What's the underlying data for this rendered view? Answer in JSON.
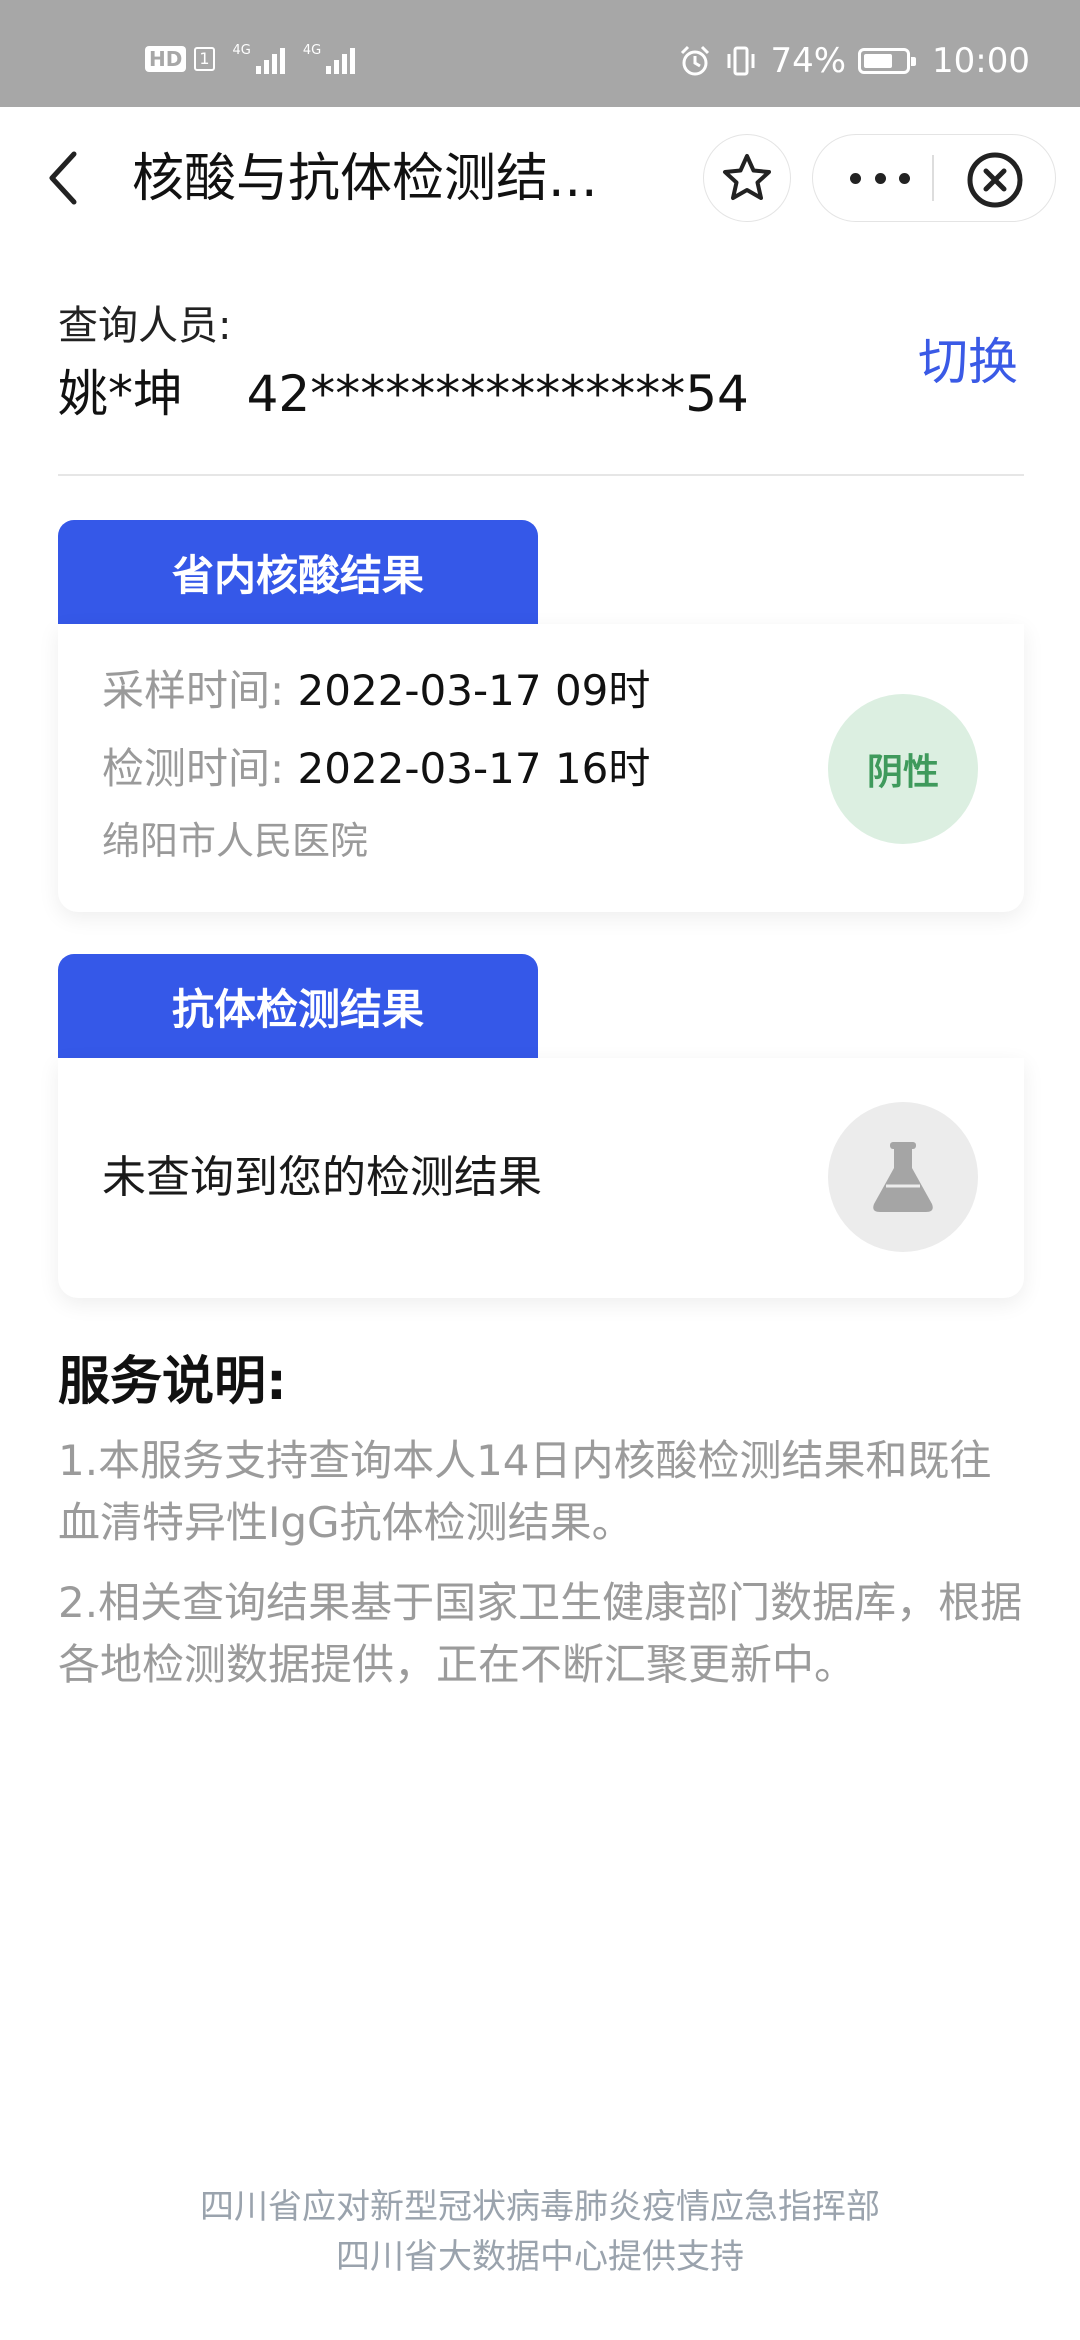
{
  "status_bar": {
    "hd": "HD",
    "sim": "1",
    "net1": "4G",
    "net2": "4G",
    "battery_pct": "74%",
    "battery_level": 0.74,
    "time": "10:00"
  },
  "nav": {
    "title": "核酸与抗体检测结..."
  },
  "user": {
    "label": "查询人员:",
    "name_id": "姚*坤    42***************54",
    "switch": "切换"
  },
  "nucleic": {
    "tab": "省内核酸结果",
    "sample_label": "采样时间:",
    "sample_value": "2022-03-17 09时",
    "test_label": "检测时间:",
    "test_value": "2022-03-17 16时",
    "hospital": "绵阳市人民医院",
    "result": "阴性"
  },
  "antibody": {
    "tab": "抗体检测结果",
    "message": "未查询到您的检测结果"
  },
  "service": {
    "title": "服务说明:",
    "p1": "1.本服务支持查询本人14日内核酸检测结果和既往血清特异性IgG抗体检测结果。",
    "p2": "2.相关查询结果基于国家卫生健康部门数据库，根据各地检测数据提供，正在不断汇聚更新中。"
  },
  "footer": {
    "line1": "四川省应对新型冠状病毒肺炎疫情应急指挥部",
    "line2": "四川省大数据中心提供支持"
  },
  "colors": {
    "accent": "#3558e8",
    "negative_bg": "#dcefe1",
    "negative_text": "#3f9a5c",
    "status_bar": "#a7a7a7"
  }
}
